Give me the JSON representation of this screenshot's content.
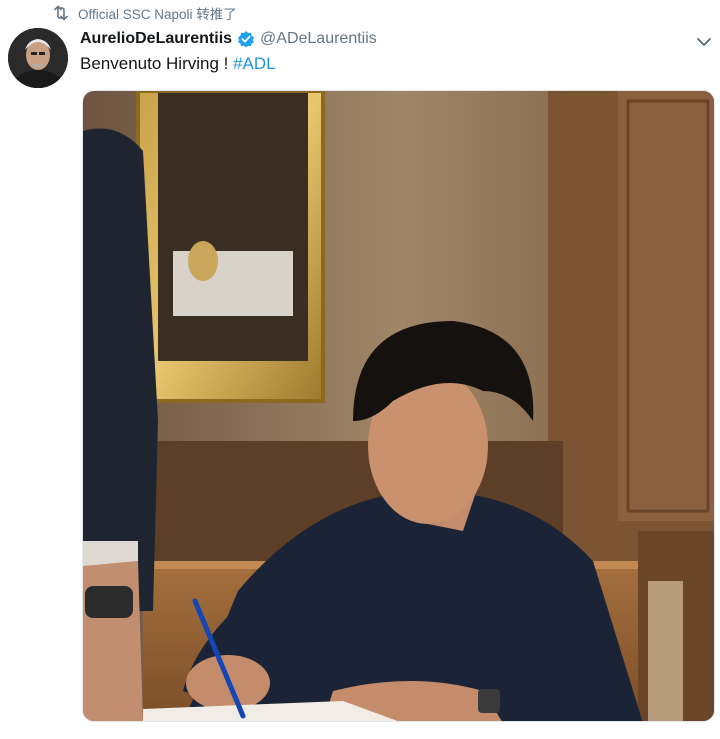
{
  "retweet": {
    "icon": "retweet-icon",
    "label": "Official SSC Napoli 转推了"
  },
  "tweet": {
    "display_name": "AurelioDeLaurentiis",
    "verified": true,
    "handle": "@ADeLaurentiis",
    "text": "Benvenuto Hirving ! ",
    "hashtag": "#ADL",
    "more_icon": "chevron-down-icon",
    "media_alt": "photo"
  },
  "colors": {
    "link": "#1b95e0",
    "secondary_text": "#657786",
    "verified": "#1da1f2"
  }
}
